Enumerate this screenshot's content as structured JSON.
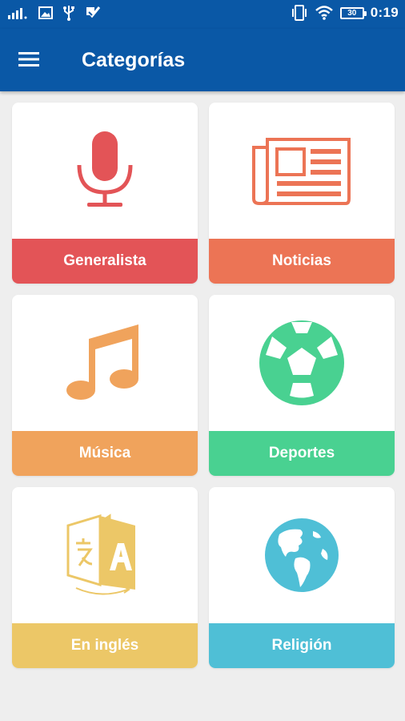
{
  "status_bar": {
    "battery": "30",
    "time": "0:19",
    "icons": [
      "signal-icon",
      "image-icon",
      "usb-icon",
      "check-box-icon",
      "vibrate-icon",
      "wifi-icon",
      "battery-icon"
    ]
  },
  "app_bar": {
    "title": "Categorías",
    "menu_icon": "hamburger-menu-icon"
  },
  "categories": [
    {
      "label": "Generalista",
      "icon": "microphone-icon",
      "color": "#e35457"
    },
    {
      "label": "Noticias",
      "icon": "newspaper-icon",
      "color": "#ec7455"
    },
    {
      "label": "Música",
      "icon": "music-note-icon",
      "color": "#f0a35c"
    },
    {
      "label": "Deportes",
      "icon": "soccer-ball-icon",
      "color": "#49d191"
    },
    {
      "label": "En inglés",
      "icon": "translate-icon",
      "color": "#ecc767"
    },
    {
      "label": "Religión",
      "icon": "globe-icon",
      "color": "#4fbfd6"
    }
  ]
}
